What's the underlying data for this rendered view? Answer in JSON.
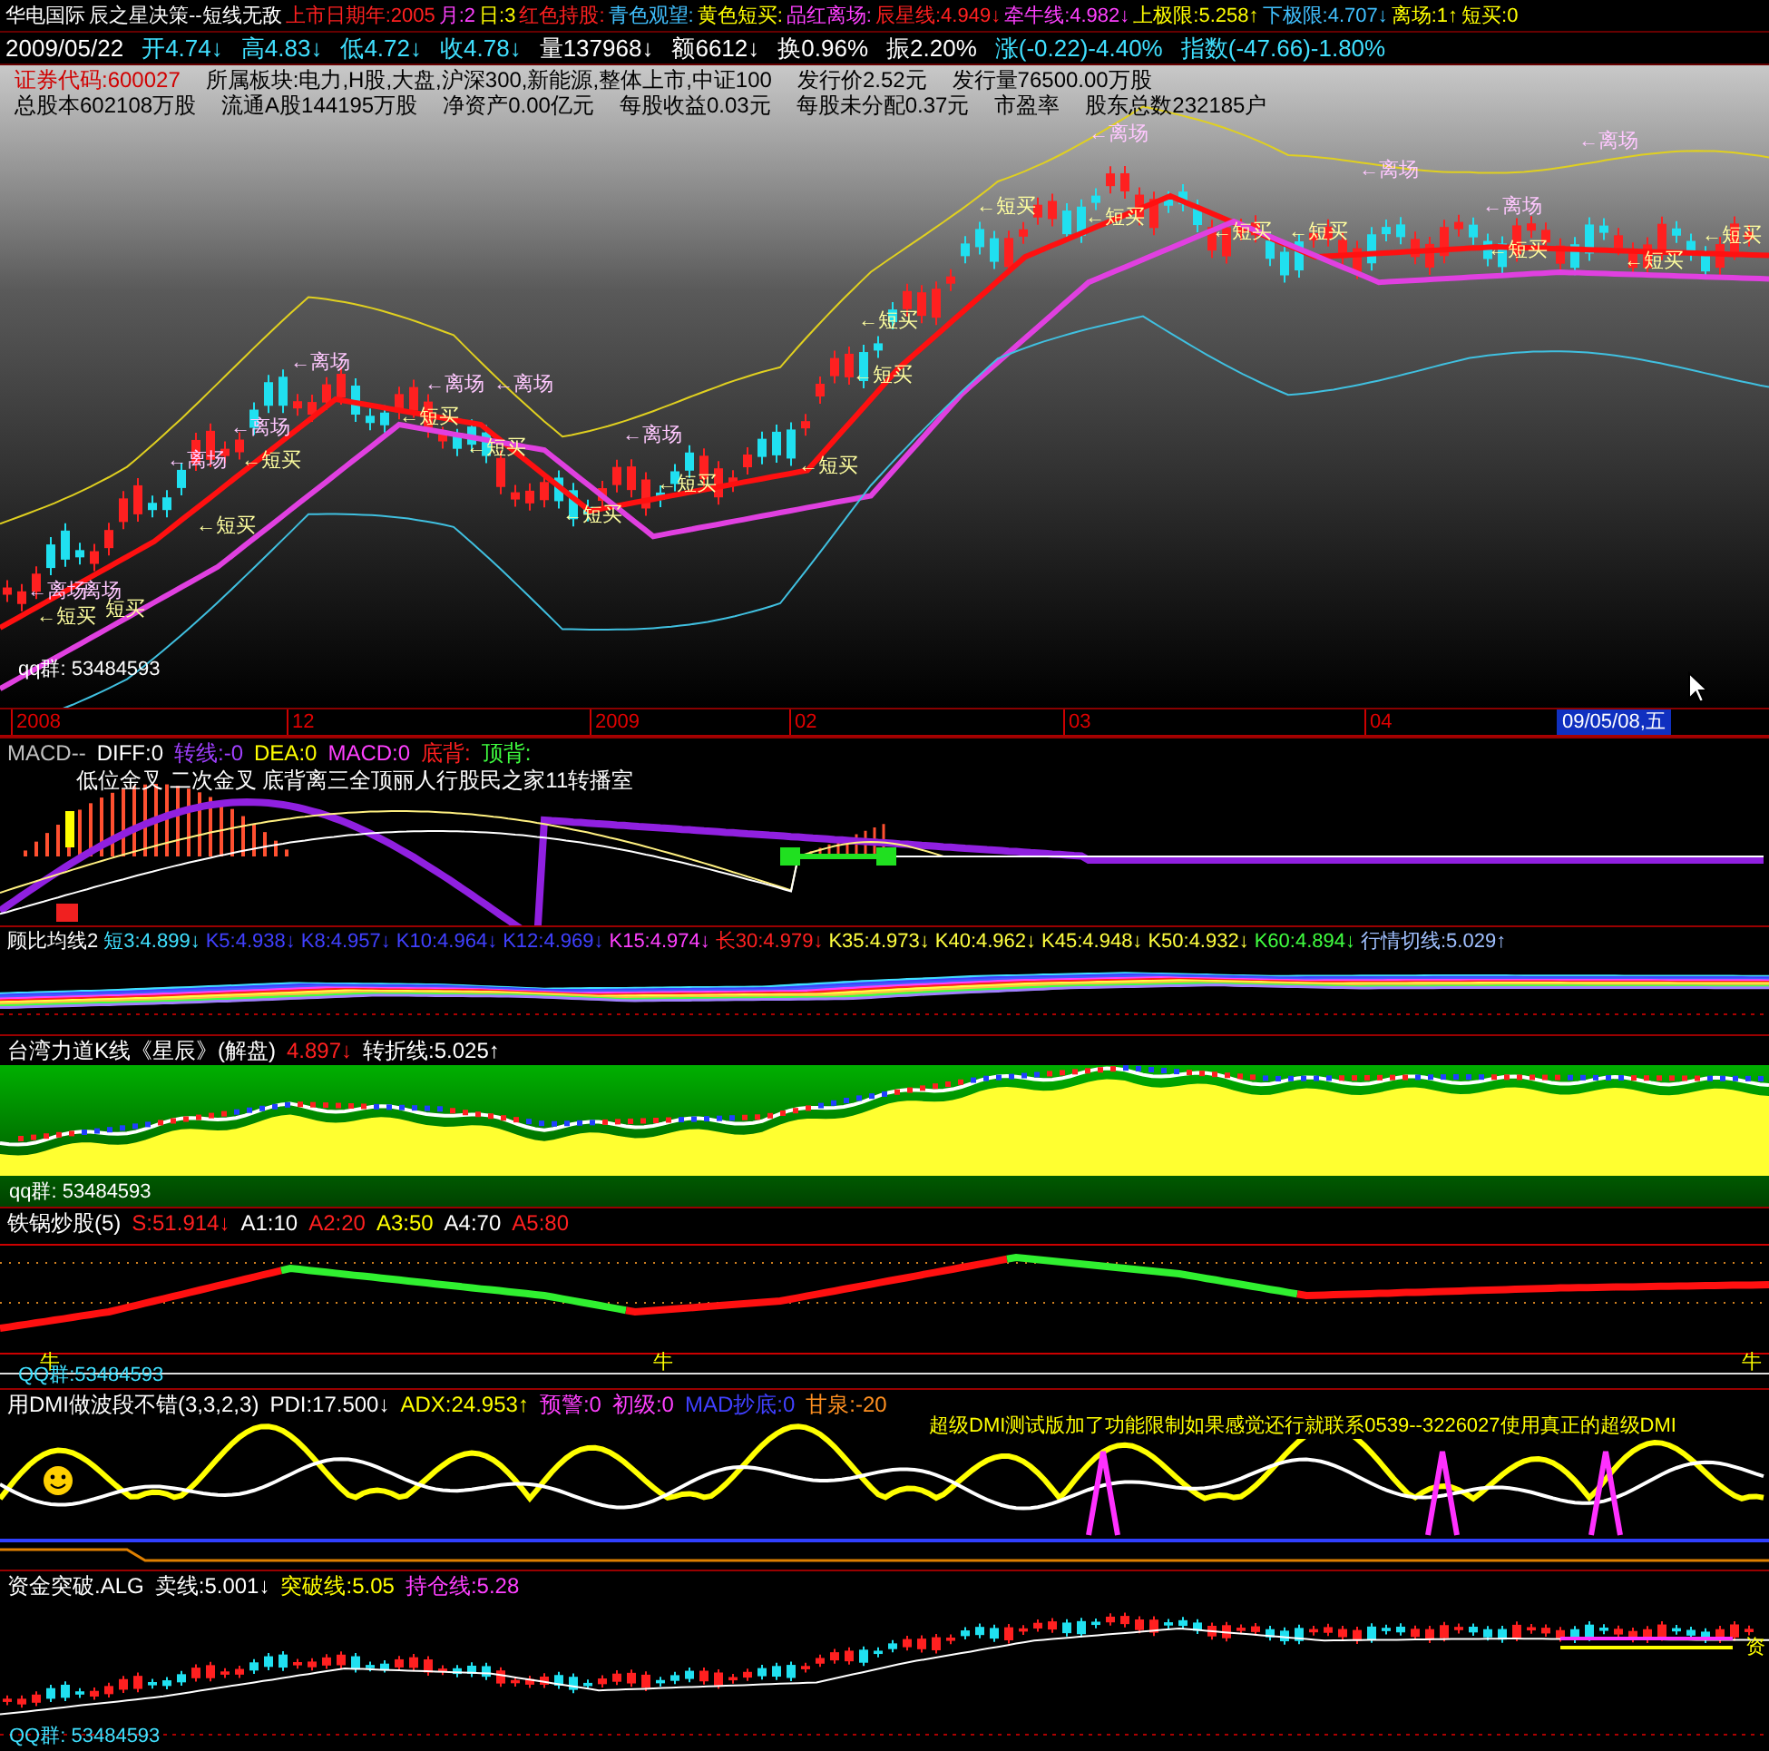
{
  "title_bar": {
    "segments": [
      {
        "text": "华电国际",
        "color": "#ffffff"
      },
      {
        "text": "辰之星决策--短线无敌",
        "color": "#ffffff"
      },
      {
        "text": "上市日期年:2005",
        "color": "#ff2020"
      },
      {
        "text": "月:2",
        "color": "#ff40ff"
      },
      {
        "text": "日:3",
        "color": "#ffff00"
      },
      {
        "text": "红色持股:",
        "color": "#ff2020"
      },
      {
        "text": "青色观望:",
        "color": "#40c0ff"
      },
      {
        "text": "黄色短买:",
        "color": "#ffff00"
      },
      {
        "text": "品红离场:",
        "color": "#ff40ff"
      },
      {
        "text": "辰星线:4.949↓",
        "color": "#ff2020"
      },
      {
        "text": "牵牛线:4.982↓",
        "color": "#ff40ff"
      },
      {
        "text": "上极限:5.258↑",
        "color": "#ffff00"
      },
      {
        "text": "下极限:4.707↓",
        "color": "#40c0ff"
      },
      {
        "text": "离场:1↑",
        "color": "#ffff00"
      },
      {
        "text": "短买:0",
        "color": "#ffff00"
      }
    ]
  },
  "quote_bar": {
    "segments": [
      {
        "text": "2009/05/22",
        "kind": "date"
      },
      {
        "text": "开4.74↓",
        "kind": "price"
      },
      {
        "text": "高4.83↓",
        "kind": "price"
      },
      {
        "text": "低4.72↓",
        "kind": "price"
      },
      {
        "text": "收4.78↓",
        "kind": "price"
      },
      {
        "text": "量137968↓",
        "kind": "trade"
      },
      {
        "text": "额6612↓",
        "kind": "trade"
      },
      {
        "text": "换0.96%",
        "kind": "trade"
      },
      {
        "text": "振2.20%",
        "kind": "trade"
      },
      {
        "text": "涨(-0.22)-4.40%",
        "kind": "change"
      },
      {
        "text": "指数(-47.66)-1.80%",
        "kind": "change"
      }
    ]
  },
  "main_chart": {
    "info_lines": [
      [
        {
          "text": "证券代码:600027",
          "color": "#d00000"
        },
        {
          "text": "所属板块:电力,H股,大盘,沪深300,新能源,整体上市,中证100",
          "color": "#000000"
        },
        {
          "text": "发行价2.52元",
          "color": "#000000"
        },
        {
          "text": "发行量76500.00万股",
          "color": "#000000"
        }
      ],
      [
        {
          "text": "总股本602108万股",
          "color": "#000000"
        },
        {
          "text": "流通A股144195万股",
          "color": "#000000"
        },
        {
          "text": "净资产0.00亿元",
          "color": "#000000"
        },
        {
          "text": "每股收益0.03元",
          "color": "#000000"
        },
        {
          "text": "每股未分配0.37元",
          "color": "#000000"
        },
        {
          "text": "市盈率",
          "color": "#000000"
        },
        {
          "text": "股东总数232185户",
          "color": "#000000"
        }
      ]
    ],
    "markers": [
      {
        "text": "←离场",
        "kind": "exit"
      },
      {
        "text": "离场",
        "kind": "exit"
      },
      {
        "text": "←短买",
        "kind": "buy"
      },
      {
        "text": "短买",
        "kind": "buy"
      },
      {
        "text": "←离场",
        "kind": "exit"
      },
      {
        "text": "←短买",
        "kind": "buy"
      },
      {
        "text": "←离场",
        "kind": "exit"
      },
      {
        "text": "←短买",
        "kind": "buy"
      },
      {
        "text": "←离场",
        "kind": "exit"
      },
      {
        "text": "←短买",
        "kind": "buy"
      },
      {
        "text": "←离场",
        "kind": "exit"
      },
      {
        "text": "←离场",
        "kind": "exit"
      },
      {
        "text": "←短买",
        "kind": "buy"
      },
      {
        "text": "←短买",
        "kind": "buy"
      },
      {
        "text": "←离场",
        "kind": "exit"
      },
      {
        "text": "←短买",
        "kind": "buy"
      },
      {
        "text": "←短买",
        "kind": "buy"
      },
      {
        "text": "←短买",
        "kind": "buy"
      },
      {
        "text": "←短买",
        "kind": "buy"
      },
      {
        "text": "←短买",
        "kind": "buy"
      },
      {
        "text": "←短买",
        "kind": "buy"
      },
      {
        "text": "←离场",
        "kind": "exit"
      },
      {
        "text": "←短买",
        "kind": "buy"
      },
      {
        "text": "←短买",
        "kind": "buy"
      },
      {
        "text": "←离场",
        "kind": "exit"
      },
      {
        "text": "←离场",
        "kind": "exit"
      },
      {
        "text": "←离场",
        "kind": "exit"
      },
      {
        "text": "←短买",
        "kind": "buy"
      },
      {
        "text": "←短买",
        "kind": "buy"
      },
      {
        "text": "←短买",
        "kind": "buy"
      }
    ],
    "qq_label": "qq群: 53484593"
  },
  "time_axis": {
    "labels": [
      "2008",
      "12",
      "2009",
      "02",
      "03",
      "04"
    ],
    "cursor_date": "09/05/08,五"
  },
  "indicators": [
    {
      "kind": "macd",
      "legend": [
        {
          "text": "MACD--",
          "color": "#c0c0c0"
        },
        {
          "text": "DIFF:0",
          "color": "#ffffff"
        },
        {
          "text": "转线:-0",
          "color": "#a040ff"
        },
        {
          "text": "DEA:0",
          "color": "#ffff00"
        },
        {
          "text": "MACD:0",
          "color": "#ff40ff"
        },
        {
          "text": "底背:",
          "color": "#ff2020"
        },
        {
          "text": "顶背:",
          "color": "#40ff40"
        }
      ],
      "notes": "低位金叉 二次金叉 底背离三全顶丽人行股民之家11转播室"
    },
    {
      "kind": "guppy",
      "legend": [
        {
          "text": "顾比均线2",
          "color": "#ffffff"
        },
        {
          "text": "短3:4.899↓",
          "color": "#40e0ff"
        },
        {
          "text": "K5:4.938↓",
          "color": "#4040ff"
        },
        {
          "text": "K8:4.957↓",
          "color": "#4040ff"
        },
        {
          "text": "K10:4.964↓",
          "color": "#4040ff"
        },
        {
          "text": "K12:4.969↓",
          "color": "#4040ff"
        },
        {
          "text": "K15:4.974↓",
          "color": "#ff40ff"
        },
        {
          "text": "长30:4.979↓",
          "color": "#ff2020"
        },
        {
          "text": "K35:4.973↓",
          "color": "#ffff40"
        },
        {
          "text": "K40:4.962↓",
          "color": "#ffff40"
        },
        {
          "text": "K45:4.948↓",
          "color": "#ffff40"
        },
        {
          "text": "K50:4.932↓",
          "color": "#ffff40"
        },
        {
          "text": "K60:4.894↓",
          "color": "#40ff40"
        },
        {
          "text": "行情切线:5.029↑",
          "color": "#a0c0ff"
        }
      ]
    },
    {
      "kind": "power_k",
      "legend": [
        {
          "text": "台湾力道K线《星辰》(解盘)",
          "color": "#ffffff"
        },
        {
          "text": "4.897↓",
          "color": "#ff2020"
        },
        {
          "text": "转折线:5.025↑",
          "color": "#ffffff"
        }
      ],
      "annotations": [
        {
          "text": "qq群: 53484593",
          "color": "#ffffff"
        }
      ]
    },
    {
      "kind": "wok",
      "legend": [
        {
          "text": "铁锅炒股(5)",
          "color": "#ffffff"
        },
        {
          "text": "S:51.914↓",
          "color": "#ff2020"
        },
        {
          "text": "A1:10",
          "color": "#ffffff"
        },
        {
          "text": "A2:20",
          "color": "#ff2020"
        },
        {
          "text": "A3:50",
          "color": "#ffff00"
        },
        {
          "text": "A4:70",
          "color": "#ffffff"
        },
        {
          "text": "A5:80",
          "color": "#ff2020"
        }
      ],
      "annotations": [
        {
          "text": "牛",
          "color": "#ffff00"
        },
        {
          "text": "牛",
          "color": "#ffff00"
        },
        {
          "text": "牛",
          "color": "#ffff00"
        },
        {
          "text": "QQ群:53484593",
          "color": "#40e0ff"
        }
      ]
    },
    {
      "kind": "dmi",
      "legend": [
        {
          "text": "用DMI做波段不错(3,3,2,3)",
          "color": "#ffffff"
        },
        {
          "text": "PDI:17.500↓",
          "color": "#ffffff"
        },
        {
          "text": "ADX:24.953↑",
          "color": "#ffff00"
        },
        {
          "text": "预警:0",
          "color": "#ff40ff"
        },
        {
          "text": "初级:0",
          "color": "#ff40ff"
        },
        {
          "text": "MAD抄底:0",
          "color": "#4040ff"
        },
        {
          "text": "甘泉:-20",
          "color": "#ff9020"
        }
      ],
      "annotations": [
        {
          "text": "超级DMI测试版加了功能限制如果感觉还行就联系0539--3226027使用真正的超级DMI",
          "color": "#ffff00"
        }
      ]
    },
    {
      "kind": "capital",
      "legend": [
        {
          "text": "资金突破.ALG",
          "color": "#ffffff"
        },
        {
          "text": "卖线:5.001↓",
          "color": "#ffffff"
        },
        {
          "text": "突破线:5.05",
          "color": "#ffff00"
        },
        {
          "text": "持仓线:5.28",
          "color": "#ff40ff"
        }
      ],
      "annotations": [
        {
          "text": "资",
          "color": "#ffff00"
        },
        {
          "text": "QQ群: 53484593",
          "color": "#40e0ff"
        }
      ]
    }
  ]
}
